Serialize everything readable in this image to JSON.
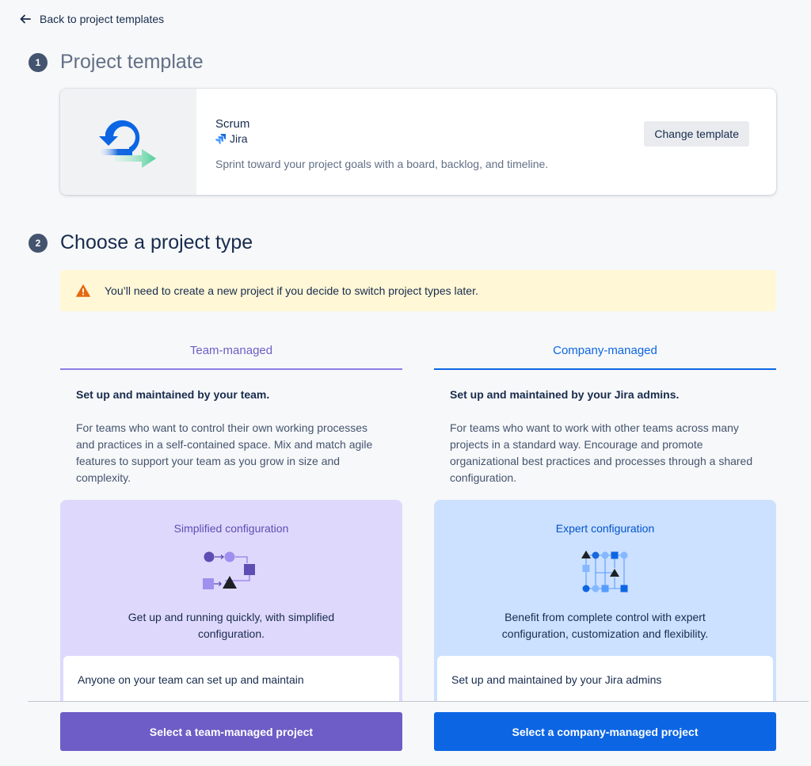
{
  "nav": {
    "back_label": "Back to project templates"
  },
  "step1": {
    "number": "1",
    "title": "Project template"
  },
  "template": {
    "name": "Scrum",
    "product": "Jira",
    "description": "Sprint toward your project goals with a board, backlog, and timeline.",
    "change_button": "Change template"
  },
  "step2": {
    "number": "2",
    "title": "Choose a project type"
  },
  "warning": {
    "text": "You’ll need to create a new project if you decide to switch project types later."
  },
  "team": {
    "tab": "Team-managed",
    "subtitle": "Set up and maintained by your team.",
    "description": "For teams who want to control their own working processes and practices in a self-contained space. Mix and match agile features to support your team as you grow in size and complexity.",
    "config_title": "Simplified configuration",
    "config_desc": "Get up and running quickly, with simplified configuration.",
    "detail": "Anyone on your team can set up and maintain",
    "button": "Select a team-managed project"
  },
  "company": {
    "tab": "Company-managed",
    "subtitle": "Set up and maintained by your Jira admins.",
    "description": "For teams who want to work with other teams across many projects in a standard way. Encourage and promote organizational best practices and processes through a shared configuration.",
    "config_title": "Expert configuration",
    "config_desc": "Benefit from complete control with expert configuration, customization and flexibility.",
    "detail": "Set up and maintained by your Jira admins",
    "button": "Select a company-managed project"
  },
  "colors": {
    "team_accent": "#6e5dc6",
    "company_accent": "#0c66e4",
    "warning_bg": "#fff7d6",
    "warning_icon": "#e56910"
  }
}
